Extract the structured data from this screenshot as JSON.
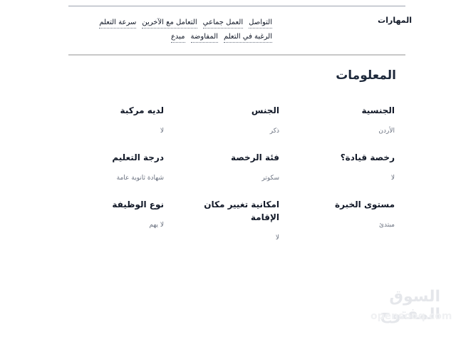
{
  "skills": {
    "label": "المهارات",
    "items": [
      "التواصل",
      "العمل جماعي",
      "التعامل مع الآخرين",
      "سرعة التعلم",
      "الرغبة في التعلم",
      "المفاوضة",
      "مبدع"
    ]
  },
  "info": {
    "title": "المعلومات",
    "fields": [
      {
        "label": "الجنسية",
        "value": "الأردن"
      },
      {
        "label": "الجنس",
        "value": "ذكر"
      },
      {
        "label": "لديه مركبة",
        "value": "لا"
      },
      {
        "label": "رخصة قيادة؟",
        "value": "لا"
      },
      {
        "label": "فئة الرخصة",
        "value": "سكوتر"
      },
      {
        "label": "درجة التعليم",
        "value": "شهادة ثانوية عامة"
      },
      {
        "label": "مستوى الخبرة",
        "value": "مبتدئ"
      },
      {
        "label": "امكانية تغيير مكان الإقامة",
        "value": "لا"
      },
      {
        "label": "نوع الوظيفة",
        "value": "لا يهم"
      }
    ]
  },
  "watermark": {
    "arabic": "السوق المفتوح",
    "english": "opensooq.com"
  }
}
